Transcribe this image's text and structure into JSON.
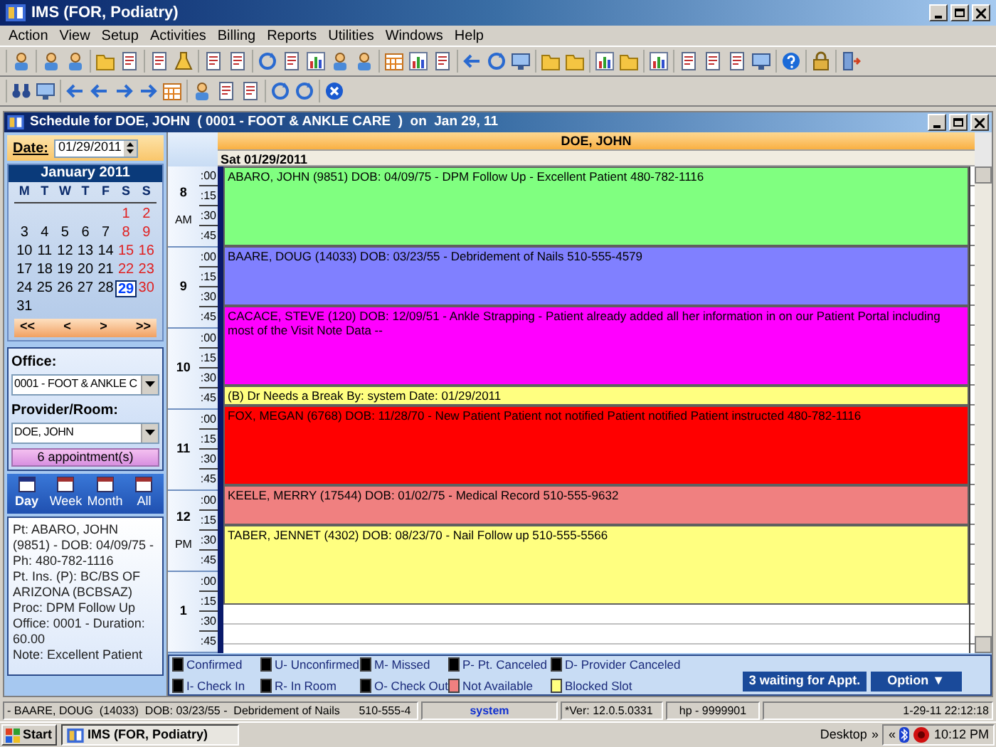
{
  "window": {
    "title": "IMS (FOR, Podiatry)"
  },
  "menu": [
    "Action",
    "View",
    "Setup",
    "Activities",
    "Billing",
    "Reports",
    "Utilities",
    "Windows",
    "Help"
  ],
  "schedule_window": {
    "title": "Schedule for DOE, JOHN  ( 0001 - FOOT & ANKLE CARE  )  on  Jan 29, 11"
  },
  "date_field": {
    "label": "Date:",
    "value": "01/29/2011"
  },
  "calendar": {
    "month": "January 2011",
    "weekdays": [
      "M",
      "T",
      "W",
      "T",
      "F",
      "S",
      "S"
    ],
    "days": [
      {
        "kind": "blank"
      },
      {
        "kind": "blank"
      },
      {
        "kind": "blank"
      },
      {
        "kind": "blank"
      },
      {
        "kind": "blank"
      },
      {
        "kind": "day",
        "label": "1",
        "weekend": true,
        "selected": false
      },
      {
        "kind": "day",
        "label": "2",
        "weekend": true,
        "selected": false
      },
      {
        "kind": "day",
        "label": "3",
        "weekend": false,
        "selected": false
      },
      {
        "kind": "day",
        "label": "4",
        "weekend": false,
        "selected": false
      },
      {
        "kind": "day",
        "label": "5",
        "weekend": false,
        "selected": false
      },
      {
        "kind": "day",
        "label": "6",
        "weekend": false,
        "selected": false
      },
      {
        "kind": "day",
        "label": "7",
        "weekend": false,
        "selected": false
      },
      {
        "kind": "day",
        "label": "8",
        "weekend": true,
        "selected": false
      },
      {
        "kind": "day",
        "label": "9",
        "weekend": true,
        "selected": false
      },
      {
        "kind": "day",
        "label": "10",
        "weekend": false,
        "selected": false
      },
      {
        "kind": "day",
        "label": "11",
        "weekend": false,
        "selected": false
      },
      {
        "kind": "day",
        "label": "12",
        "weekend": false,
        "selected": false
      },
      {
        "kind": "day",
        "label": "13",
        "weekend": false,
        "selected": false
      },
      {
        "kind": "day",
        "label": "14",
        "weekend": false,
        "selected": false
      },
      {
        "kind": "day",
        "label": "15",
        "weekend": true,
        "selected": false
      },
      {
        "kind": "day",
        "label": "16",
        "weekend": true,
        "selected": false
      },
      {
        "kind": "day",
        "label": "17",
        "weekend": false,
        "selected": false
      },
      {
        "kind": "day",
        "label": "18",
        "weekend": false,
        "selected": false
      },
      {
        "kind": "day",
        "label": "19",
        "weekend": false,
        "selected": false
      },
      {
        "kind": "day",
        "label": "20",
        "weekend": false,
        "selected": false
      },
      {
        "kind": "day",
        "label": "21",
        "weekend": false,
        "selected": false
      },
      {
        "kind": "day",
        "label": "22",
        "weekend": true,
        "selected": false
      },
      {
        "kind": "day",
        "label": "23",
        "weekend": true,
        "selected": false
      },
      {
        "kind": "day",
        "label": "24",
        "weekend": false,
        "selected": false
      },
      {
        "kind": "day",
        "label": "25",
        "weekend": false,
        "selected": false
      },
      {
        "kind": "day",
        "label": "26",
        "weekend": false,
        "selected": false
      },
      {
        "kind": "day",
        "label": "27",
        "weekend": false,
        "selected": false
      },
      {
        "kind": "day",
        "label": "28",
        "weekend": false,
        "selected": false
      },
      {
        "kind": "day",
        "label": "29",
        "weekend": true,
        "selected": true
      },
      {
        "kind": "day",
        "label": "30",
        "weekend": true,
        "selected": false
      },
      {
        "kind": "day",
        "label": "31",
        "weekend": false,
        "selected": false
      }
    ],
    "nav": [
      "<<",
      "<",
      ">",
      ">>"
    ]
  },
  "office": {
    "label": "Office:",
    "value": "0001 - FOOT & ANKLE C"
  },
  "provider": {
    "label": "Provider/Room:",
    "value": "DOE, JOHN"
  },
  "appointments_button": "6 appointment(s)",
  "views": [
    {
      "label": "Day",
      "selected": true
    },
    {
      "label": "Week",
      "selected": false
    },
    {
      "label": "Month",
      "selected": false
    },
    {
      "label": "All",
      "selected": false
    }
  ],
  "details": [
    "Pt: ABARO, JOHN  (9851) - DOB: 04/09/75 - Ph: 480-782-1116",
    "Pt. Ins. (P): BC/BS OF ARIZONA (BCBSAZ)",
    "Proc: DPM Follow Up",
    "Office: 0001  - Duration: 60.00",
    "Note:  Excellent Patient"
  ],
  "schedule": {
    "provider": "DOE, JOHN",
    "date": "Sat 01/29/2011",
    "hours": [
      {
        "hour": "8",
        "period": "AM",
        "slots": [
          ":00",
          ":15",
          ":30",
          ":45"
        ]
      },
      {
        "hour": "9",
        "slots": [
          ":00",
          ":15",
          ":30",
          ":45"
        ]
      },
      {
        "hour": "10",
        "slots": [
          ":00",
          ":15",
          ":30",
          ":45"
        ]
      },
      {
        "hour": "11",
        "slots": [
          ":00",
          ":15",
          ":30",
          ":45"
        ]
      },
      {
        "hour": "12",
        "period": "PM",
        "slots": [
          ":00",
          ":15",
          ":30",
          ":45"
        ]
      },
      {
        "hour": "1",
        "slots": [
          ":00",
          ":15",
          ":30",
          ":45"
        ]
      }
    ],
    "blocks": [
      {
        "text": "ABARO, JOHN  (9851)  DOB: 04/09/75 -  DPM Follow Up  - Excellent Patient      480-782-1116",
        "color": "#80ff80",
        "kind": "hour"
      },
      {
        "text": "BAARE, DOUG  (14033)  DOB: 03/23/55 -  Debridement of Nails      510-555-4579",
        "color": "#8080ff",
        "kind": "three-quarter"
      },
      {
        "text": "CACACE, STEVE  (120)  DOB: 12/09/51 -  Ankle Strapping - Patient already added all her information in on our Patient Portal including most of the Visit Note Data      --",
        "color": "#ff00ff",
        "kind": "hour"
      },
      {
        "text": "(B) Dr Needs a Break  By: system  Date: 01/29/2011",
        "color": "#ffff80",
        "kind": "quarter"
      },
      {
        "text": "FOX, MEGAN  (6768)  DOB: 11/28/70 -  New Patient  Patient not notified  Patient notified  Patient instructed      480-782-1116",
        "color": "#ff0000",
        "kind": "hour"
      },
      {
        "text": "KEELE, MERRY  (17544)  DOB: 01/02/75 -  Medical Record      510-555-9632",
        "color": "#f08080",
        "kind": "half"
      },
      {
        "text": "TABER, JENNET  (4302)  DOB: 08/23/70 -  Nail Follow up      510-555-5566",
        "color": "#ffff80",
        "kind": "hour"
      }
    ]
  },
  "legend": [
    {
      "label": "Confirmed",
      "color": "#000000"
    },
    {
      "label": "U- Unconfirmed",
      "color": "#000000"
    },
    {
      "label": "M- Missed",
      "color": "#000000"
    },
    {
      "label": "P- Pt. Canceled",
      "color": "#000000"
    },
    {
      "label": "D- Provider Canceled",
      "color": "#000000"
    },
    {
      "label": "I- Check In",
      "color": "#000000"
    },
    {
      "label": "R- In Room",
      "color": "#000000"
    },
    {
      "label": "O- Check Out",
      "color": "#000000"
    },
    {
      "label": "Not Available",
      "color": "#f08080"
    },
    {
      "label": "Blocked Slot",
      "color": "#ffff80"
    }
  ],
  "buttons": {
    "waiting": "3 waiting for Appt.",
    "option": "Option ▼"
  },
  "status_bar": [
    "- BAARE, DOUG  (14033)  DOB: 03/23/55 -  Debridement of Nails      510-555-4",
    "system",
    "*Ver: 12.0.5.0331",
    "hp - 9999901",
    "1-29-11 22:12:18"
  ],
  "taskbar": {
    "start": "Start",
    "task": "IMS (FOR, Podiatry)",
    "toolbar": "Desktop",
    "chevron": "»",
    "tray_chevron": "«",
    "clock": "10:12 PM"
  }
}
